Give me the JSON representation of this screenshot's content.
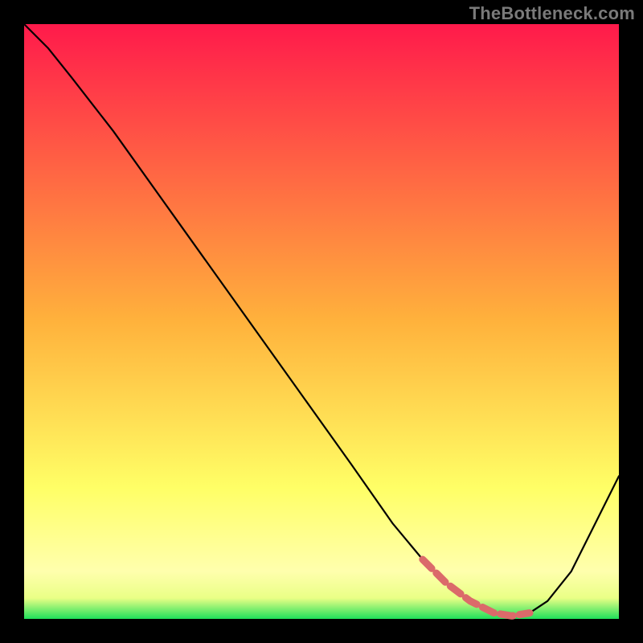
{
  "watermark": "TheBottleneck.com",
  "chart_data": {
    "type": "line",
    "title": "",
    "xlabel": "",
    "ylabel": "",
    "xlim": [
      0,
      100
    ],
    "ylim": [
      0,
      100
    ],
    "grid": false,
    "legend": false,
    "plot_bg": {
      "gradient": "vertical",
      "stops": [
        {
          "pos": 0.0,
          "color": "#ff1a4b"
        },
        {
          "pos": 0.5,
          "color": "#ffb23c"
        },
        {
          "pos": 0.78,
          "color": "#ffff66"
        },
        {
          "pos": 0.92,
          "color": "#ffffad"
        },
        {
          "pos": 0.965,
          "color": "#eaff86"
        },
        {
          "pos": 1.0,
          "color": "#1ee05a"
        }
      ]
    },
    "series": [
      {
        "name": "bottleneck-curve",
        "x": [
          0,
          4,
          8,
          15,
          25,
          35,
          45,
          55,
          62,
          67,
          71,
          75,
          79,
          82,
          85,
          88,
          92,
          96,
          100
        ],
        "y": [
          100,
          96,
          91,
          82,
          68,
          54,
          40,
          26,
          16,
          10,
          6,
          3,
          1,
          0.5,
          1,
          3,
          8,
          16,
          24
        ]
      }
    ],
    "highlight": {
      "name": "minimum-region",
      "x": [
        67,
        71,
        75,
        79,
        82,
        85
      ],
      "y": [
        10,
        6,
        3,
        1,
        0.5,
        1
      ]
    }
  }
}
